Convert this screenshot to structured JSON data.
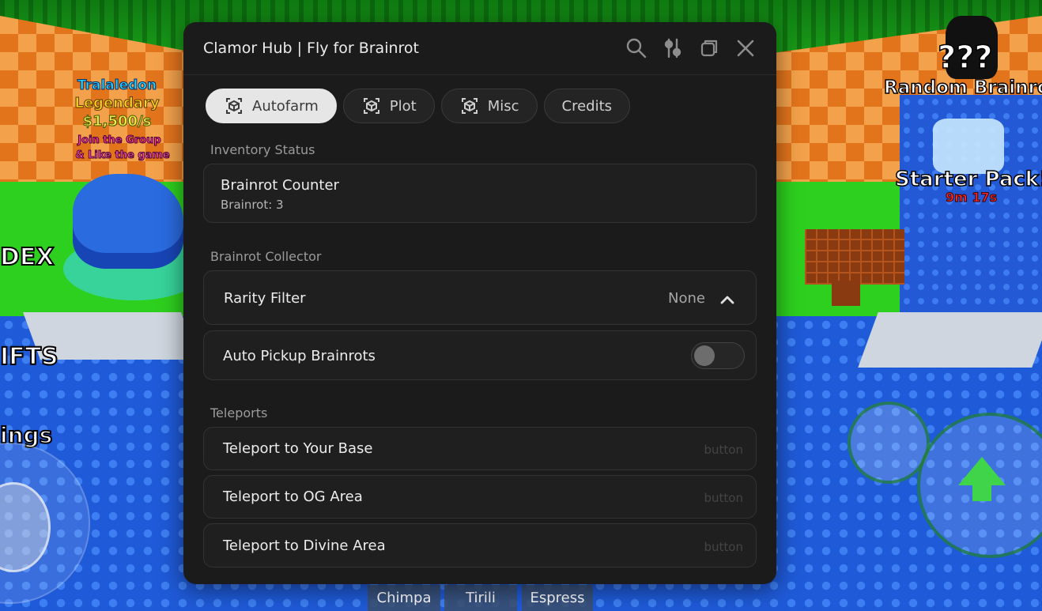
{
  "game": {
    "billboard": {
      "name": "Tralaledon",
      "rarity": "Legendary",
      "rate": "$1,500/s",
      "line1": "Join the Group",
      "line2": "& Like the game"
    },
    "left_menu": {
      "dex": "DEX",
      "gifts": "IFTS",
      "wings": "ings"
    },
    "right_menu": {
      "mystery": "???",
      "random": "Random Brainrot",
      "starter": "Starter Pack!",
      "timer": "9m 17s"
    },
    "hotbar": [
      "Chimpa",
      "Tirili",
      "Espress"
    ]
  },
  "hub": {
    "title": "Clamor Hub | Fly for Brainrot",
    "tabs": [
      {
        "label": "Autofarm",
        "icon": "box-icon",
        "active": true
      },
      {
        "label": "Plot",
        "icon": "box-icon",
        "active": false
      },
      {
        "label": "Misc",
        "icon": "box-icon",
        "active": false
      },
      {
        "label": "Credits",
        "icon": "",
        "active": false
      }
    ],
    "inventory": {
      "section": "Inventory Status",
      "counter_title": "Brainrot Counter",
      "counter_value": "Brainrot: 3"
    },
    "collector": {
      "section": "Brainrot Collector",
      "rarity_label": "Rarity Filter",
      "rarity_value": "None",
      "auto_pickup_label": "Auto Pickup Brainrots",
      "auto_pickup_on": false
    },
    "teleports": {
      "section": "Teleports",
      "button_tag": "button",
      "items": [
        "Teleport to Your Base",
        "Teleport to OG Area",
        "Teleport to Divine Area"
      ]
    }
  }
}
